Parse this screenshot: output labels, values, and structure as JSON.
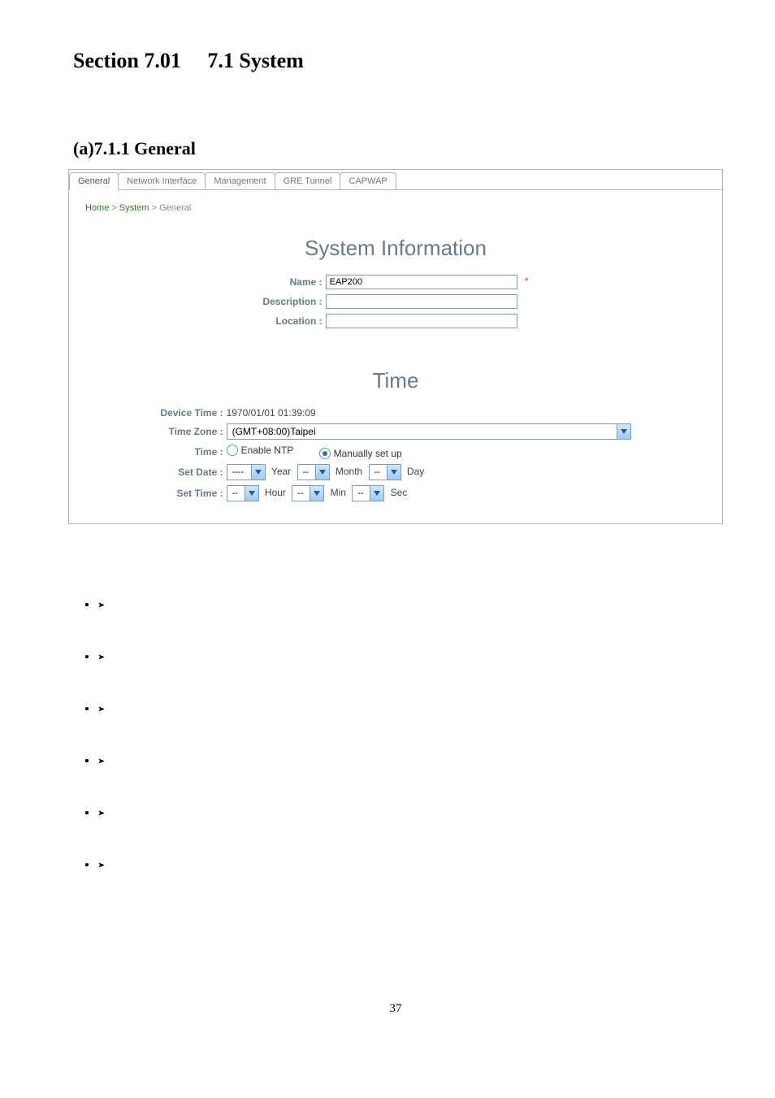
{
  "section_title": "Section 7.01  7.1 System",
  "subsection_title": "(a)7.1.1 General",
  "tabs": [
    "General",
    "Network Interface",
    "Management",
    "GRE Tunnel",
    "CAPWAP"
  ],
  "tabs_active_index": 0,
  "breadcrumb": {
    "home": "Home",
    "system": "System",
    "general": "General",
    "sep": ">"
  },
  "sys_info": {
    "title": "System Information",
    "name_label": "Name :",
    "name_value": "EAP200",
    "name_required": "*",
    "desc_label": "Description :",
    "desc_value": "",
    "loc_label": "Location :",
    "loc_value": ""
  },
  "time": {
    "title": "Time",
    "device_time_label": "Device Time :",
    "device_time_value": "1970/01/01 01:39:09",
    "timezone_label": "Time Zone :",
    "timezone_value": "(GMT+08:00)Taipei",
    "time_label": "Time :",
    "enable_ntp": "Enable NTP",
    "manual": "Manually set up",
    "set_date_label": "Set Date :",
    "year_sel": "----",
    "year_text": "Year",
    "month_sel": "--",
    "month_text": "Month",
    "day_sel": "--",
    "day_text": "Day",
    "set_time_label": "Set Time :",
    "hour_sel": "--",
    "hour_text": "Hour",
    "min_sel": "--",
    "min_text": "Min",
    "sec_sel": "--",
    "sec_text": "Sec"
  },
  "page_number": "37"
}
